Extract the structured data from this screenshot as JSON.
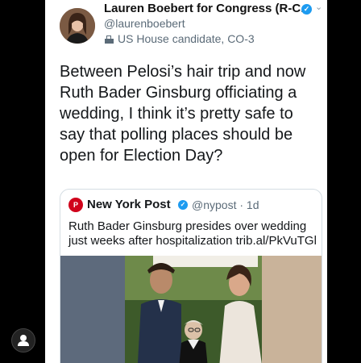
{
  "tweet": {
    "author_name": "Lauren Boebert for Congress (R-C...",
    "handle": "@laurenboebert",
    "label": "US House candidate, CO-3",
    "text": "Between Pelosi’s hair trip and now Ruth Bader Ginsburg officiating a wedding, I think it’s pretty safe to say that polling places should be open for Election Day?",
    "verified": true
  },
  "quoted": {
    "name": "New York Post",
    "handle": "@nypost · 1d",
    "text": "Ruth Bader Ginsburg presides over wedding just weeks after hospitalization trib.al/PkVuTGl",
    "verified": true
  },
  "icons": {
    "verified": "verified-badge-icon",
    "more": "chevron-down-icon",
    "label": "ballot-box-icon",
    "profile": "user-icon"
  },
  "colors": {
    "verified_blue": "#1d9bf0",
    "secondary_text": "#5b6b78",
    "nypost_red": "#d0021b"
  }
}
